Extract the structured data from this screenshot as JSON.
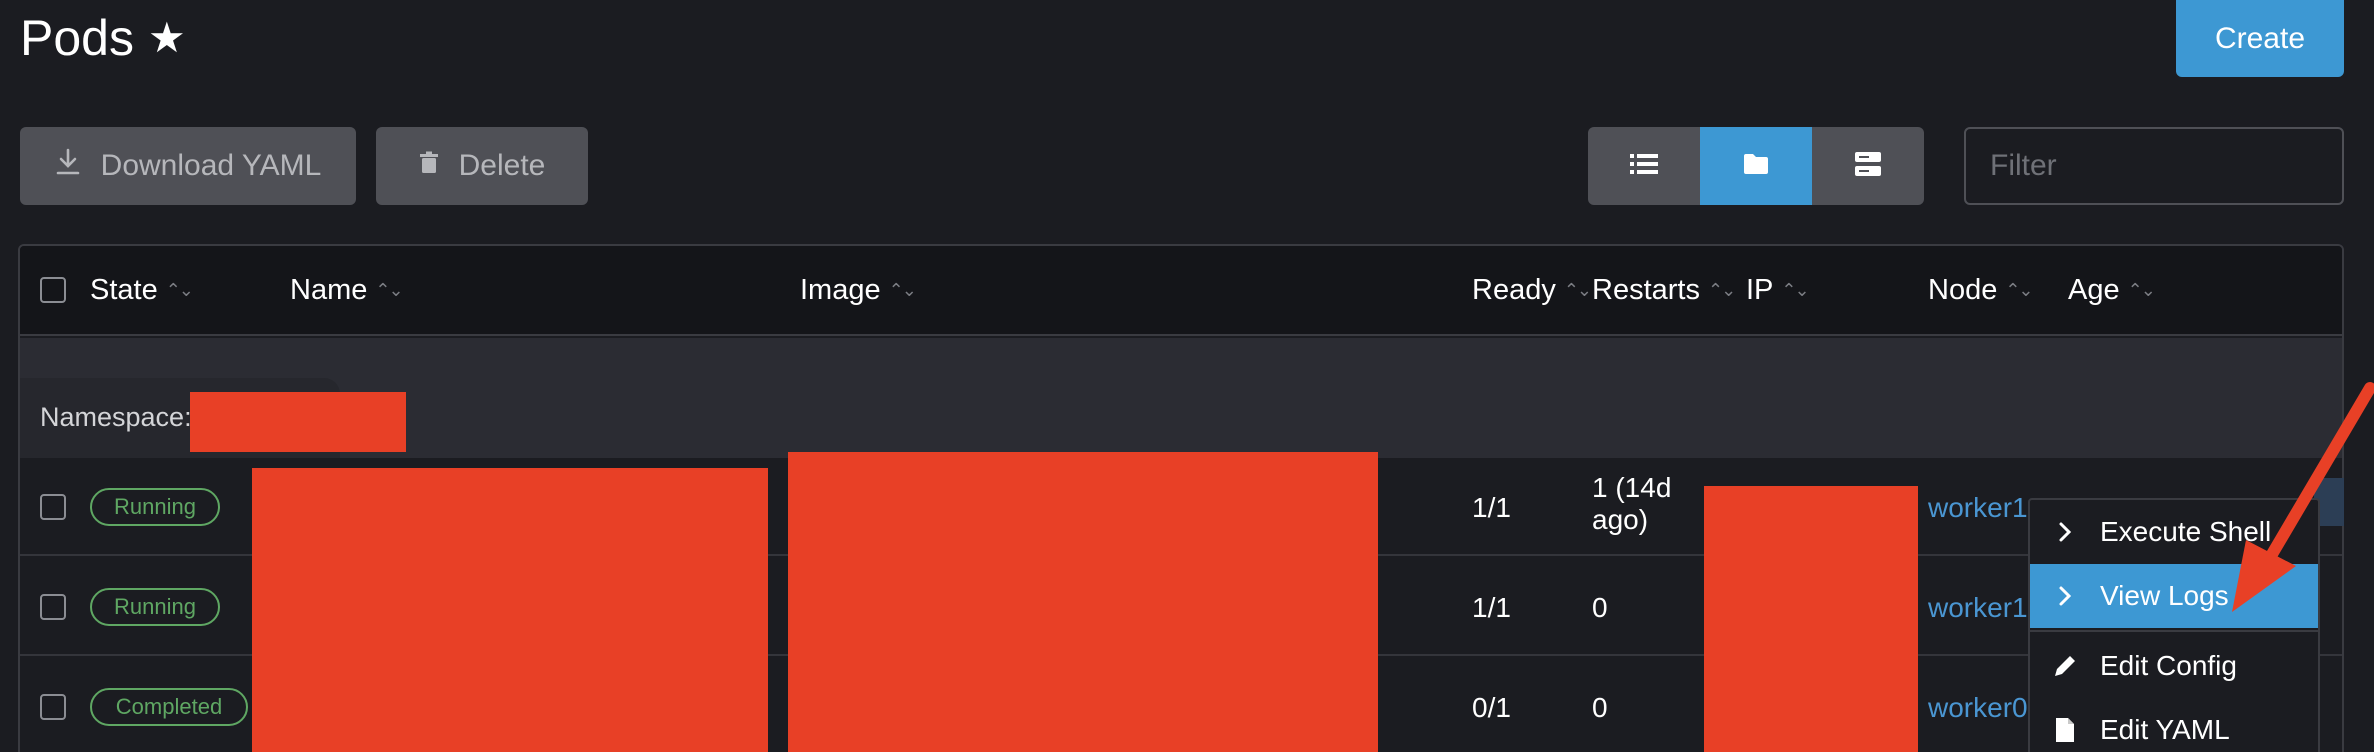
{
  "page": {
    "title": "Pods",
    "create_label": "Create"
  },
  "toolbar": {
    "download_label": "Download YAML",
    "delete_label": "Delete",
    "filter_placeholder": "Filter"
  },
  "table": {
    "columns": [
      "State",
      "Name",
      "Image",
      "Ready",
      "Restarts",
      "IP",
      "Node",
      "Age"
    ],
    "group": {
      "label": "Namespace:"
    },
    "rows": [
      {
        "state": "Running",
        "ready": "1/1",
        "restarts_line1": "1 (14d",
        "restarts_line2": "ago)",
        "node": "worker1"
      },
      {
        "state": "Running",
        "ready": "1/1",
        "restarts_line1": "0",
        "restarts_line2": "",
        "node": "worker1"
      },
      {
        "state": "Completed",
        "ready": "0/1",
        "restarts_line1": "0",
        "restarts_line2": "",
        "node": "worker0"
      }
    ]
  },
  "context_menu": {
    "items": [
      {
        "label": "Execute Shell",
        "icon": "chevron-right-icon"
      },
      {
        "label": "View Logs",
        "icon": "chevron-right-icon"
      },
      {
        "label": "Edit Config",
        "icon": "pencil-icon"
      },
      {
        "label": "Edit YAML",
        "icon": "file-icon"
      }
    ]
  },
  "colors": {
    "accent": "#3d98d3",
    "running": "#5fa763",
    "link": "#4a96d2",
    "redaction": "#e84026",
    "arrow": "#e84026"
  }
}
